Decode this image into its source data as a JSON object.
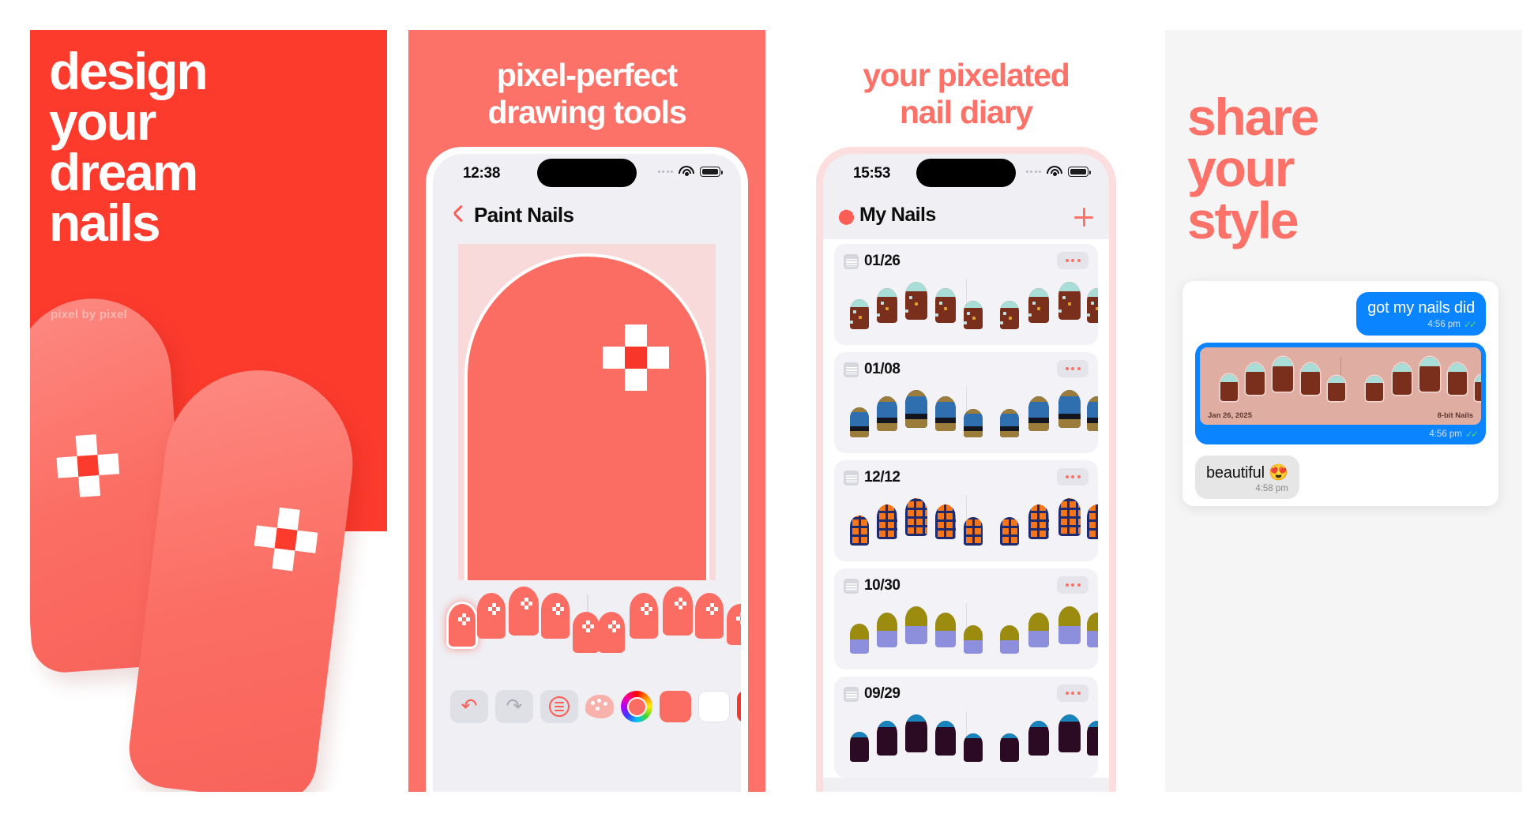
{
  "panel1": {
    "headline": "design\nyour\ndream\nnails",
    "subtitle": "pixel by pixel",
    "bg_color": "#fc3b2d",
    "nail_color": "#fb6d63"
  },
  "panel2": {
    "headline": "pixel-perfect\ndrawing tools",
    "bg_color": "#fc7168",
    "status": {
      "time": "12:38",
      "wifi": "wifi-icon",
      "battery": "battery-icon",
      "signal": "signal-dots-icon"
    },
    "nav": {
      "back": "back-chevron-icon",
      "title": "Paint Nails"
    },
    "canvas": {
      "nail_color": "#fb6d63",
      "bg_color": "#f9dadb",
      "pixel_color": "#f8362a"
    },
    "hand": {
      "selected_index": 0,
      "count_left": 5,
      "count_right": 5
    },
    "toolbar": {
      "undo": "undo-icon",
      "redo": "redo-icon",
      "layers": "layers-icon",
      "palette": "palette-icon",
      "color_wheel": "color-wheel-icon",
      "swatches": [
        "#fb6d63",
        "#ffffff",
        "#f8362a"
      ]
    }
  },
  "panel3": {
    "headline": "your pixelated\nnail diary",
    "accent": "#fc7168",
    "status": {
      "time": "15:53"
    },
    "nav": {
      "settings": "gear-icon",
      "title": "My Nails",
      "add": "plus-icon"
    },
    "entries": [
      {
        "date": "01/26",
        "menu": "more-options-icon",
        "theme": "cocoa-mint"
      },
      {
        "date": "01/08",
        "menu": "more-options-icon",
        "theme": "midnight-denim"
      },
      {
        "date": "12/12",
        "menu": "more-options-icon",
        "theme": "orange-plaid"
      },
      {
        "date": "10/30",
        "menu": "more-options-icon",
        "theme": "periwinkle-olive"
      },
      {
        "date": "09/29",
        "menu": "more-options-icon",
        "theme": "plum-teal"
      }
    ]
  },
  "panel4": {
    "headline": "share\nyour\nstyle",
    "accent": "#fc7168",
    "bg_color": "#f5f5f5",
    "chat": {
      "messages": [
        {
          "side": "out",
          "text": "got my nails did",
          "time": "4:56 pm",
          "read": "double-check-icon"
        },
        {
          "side": "out",
          "type": "photo",
          "time": "4:56 pm",
          "read": "double-check-icon",
          "caption_left": "Jan 26, 2025",
          "caption_right": "8-bit Nails"
        },
        {
          "side": "in",
          "text": "beautiful 😍",
          "time": "4:58 pm"
        }
      ]
    }
  },
  "nail_themes": {
    "cocoa-mint": {
      "base": "#7a2f1c",
      "tip": "#a9ddd7",
      "tip_h": 26,
      "speck": true
    },
    "midnight-denim": {
      "base": "#14161f",
      "tip": "#2f6fb0",
      "tip_h": 62,
      "gold": "#9c7c3a"
    },
    "orange-plaid": {
      "base": "#f4751a",
      "tip": "#1e2a6e",
      "tip_h": 0,
      "plaid": true
    },
    "periwinkle-olive": {
      "base": "#8d8fdc",
      "tip": "#9b8c10",
      "tip_h": 52
    },
    "plum-teal": {
      "base": "#2b0b23",
      "tip": "#1884bb",
      "tip_h": 18
    }
  }
}
